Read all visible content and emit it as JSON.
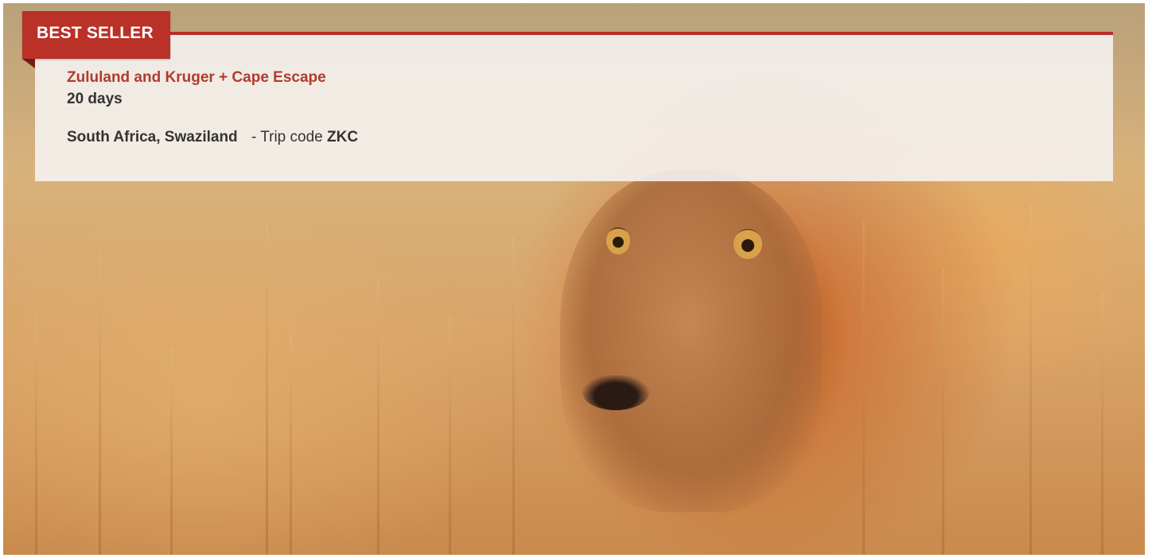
{
  "badge": {
    "label": "BEST SELLER",
    "color": "#b93127"
  },
  "trip": {
    "title": "Zululand and Kruger + Cape Escape",
    "duration": "20 days",
    "countries": "South Africa, Swaziland",
    "code_prefix": "- Trip code",
    "code": "ZKC"
  },
  "image": {
    "subject": "lion-in-grass-photo"
  },
  "colors": {
    "accent": "#b23a2e",
    "text": "#333333",
    "panel": "#f6f4f3"
  }
}
